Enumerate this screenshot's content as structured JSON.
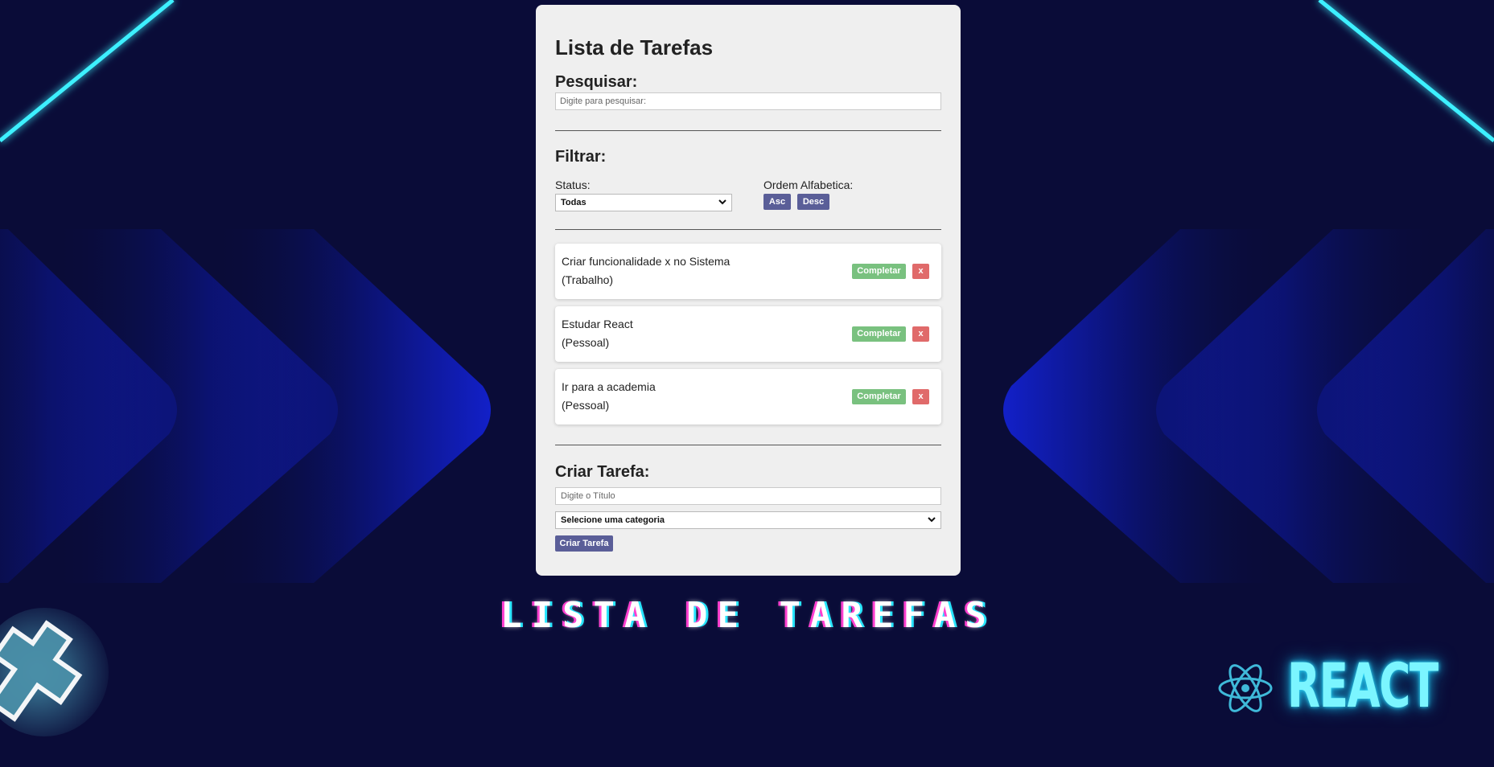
{
  "app": {
    "title": "Lista de Tarefas",
    "search": {
      "heading": "Pesquisar:",
      "placeholder": "Digite para pesquisar:"
    },
    "filter": {
      "heading": "Filtrar:",
      "status_label": "Status:",
      "status_value": "Todas",
      "order_label": "Ordem Alfabetica:",
      "asc_label": "Asc",
      "desc_label": "Desc"
    },
    "todos": [
      {
        "text": "Criar funcionalidade x no Sistema",
        "category": "(Trabalho)"
      },
      {
        "text": "Estudar React",
        "category": "(Pessoal)"
      },
      {
        "text": "Ir para a academia",
        "category": "(Pessoal)"
      }
    ],
    "todo_buttons": {
      "complete_label": "Completar",
      "remove_label": "x"
    },
    "create": {
      "heading": "Criar Tarefa:",
      "title_placeholder": "Digite o Título",
      "category_value": "Selecione uma categoria",
      "submit_label": "Criar Tarefa"
    }
  },
  "background": {
    "banner_text": "LISTA DE TAREFAS",
    "react_text": "REACT"
  },
  "colors": {
    "background": "#0a0c38",
    "card": "#efefef",
    "accent_button": "#5a5e98",
    "complete_button": "#79c17f",
    "remove_button": "#e06a6a",
    "neon": "#2ee0ff"
  }
}
